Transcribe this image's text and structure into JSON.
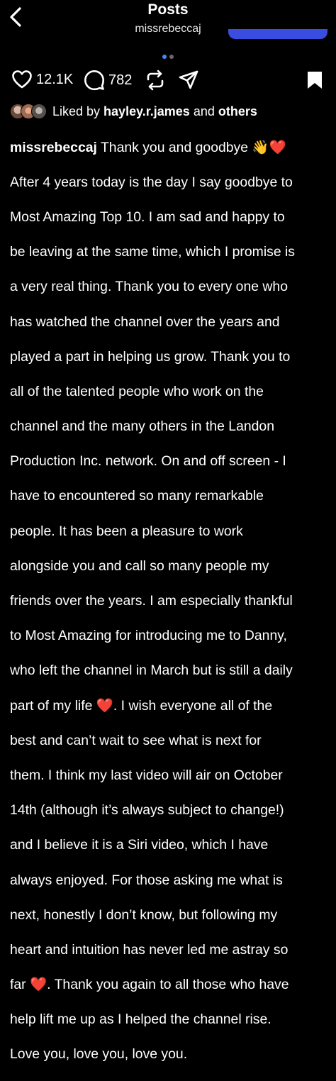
{
  "header": {
    "title": "Posts",
    "username": "missrebeccaj",
    "back_icon": "chevron-left-icon"
  },
  "carousel": {
    "current": 1,
    "total": 2,
    "active_color": "#3d8bff"
  },
  "actions": {
    "likes": "12.1K",
    "comments": "782",
    "icons": [
      "heart-icon",
      "comment-icon",
      "repost-icon",
      "share-icon",
      "bookmark-icon"
    ]
  },
  "liked_by": {
    "prefix": "Liked by ",
    "user": "hayley.r.james",
    "connector": " and ",
    "others": "others"
  },
  "post": {
    "author": "missrebeccaj",
    "lines": [
      "Thank you and goodbye 👋❤️",
      "After 4 years today is the day I say goodbye to",
      "Most Amazing Top 10. I am sad and happy to",
      "be leaving at the same time, which I promise is",
      "a very real thing. Thank you to every one who",
      "has watched the channel over the years and",
      "played a part in helping us grow. Thank you to",
      "all of the talented people who work on the",
      "channel and the many others in the Landon",
      "Production Inc. network. On and off screen - I",
      "have to encountered so many remarkable",
      "people. It has been a pleasure to work",
      "alongside you and call so many people my",
      "friends over the years. I am especially thankful",
      "to Most Amazing for introducing me to Danny,",
      "who left the channel in March but is still a daily",
      "part of my life ❤️. I wish everyone all of the",
      "best and can’t wait to see what is next for",
      "them. I think my last video will air on October",
      "14th (although it’s always subject to change!)",
      "and I believe it is a Siri video, which I have",
      "always enjoyed. For those asking me what is",
      "next, honestly I don’t know, but following my",
      "heart and intuition has never led me astray so",
      "far ❤️. Thank you again to all those who have",
      "help lift me up as I helped the channel rise.",
      "Love you, love you, love you."
    ]
  }
}
